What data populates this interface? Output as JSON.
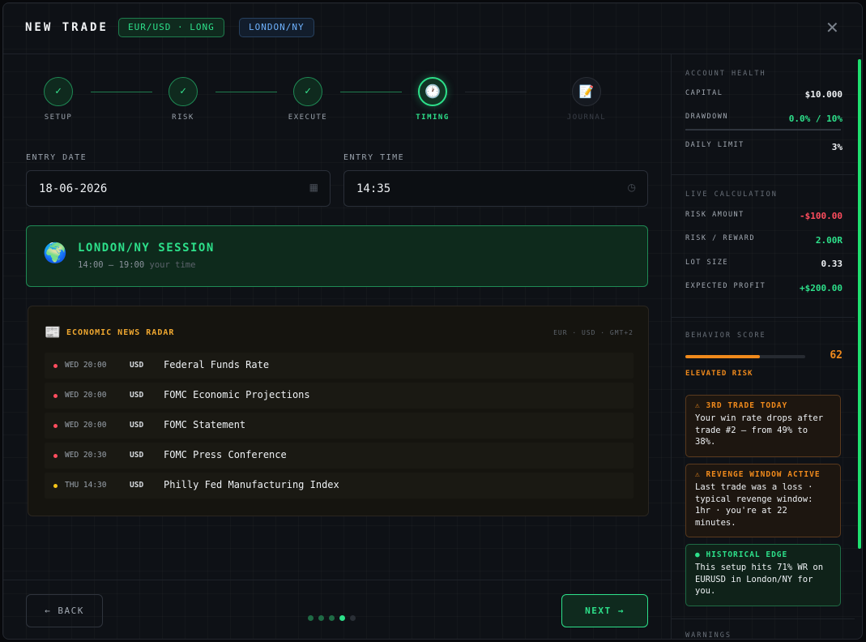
{
  "header": {
    "title": "NEW TRADE",
    "pair_pill": "EUR/USD · LONG",
    "session_pill": "LONDON/NY",
    "close_icon": "close-icon"
  },
  "stepper": {
    "steps": [
      {
        "label": "SETUP",
        "glyph": "✓",
        "state": "done"
      },
      {
        "label": "RISK",
        "glyph": "✓",
        "state": "done"
      },
      {
        "label": "EXECUTE",
        "glyph": "✓",
        "state": "done"
      },
      {
        "label": "TIMING",
        "glyph": "🕐",
        "state": "current"
      },
      {
        "label": "JOURNAL",
        "glyph": "📝",
        "state": "future"
      }
    ]
  },
  "form": {
    "entry_date_label": "ENTRY DATE",
    "entry_date_value": "18-06-2026",
    "entry_time_label": "ENTRY TIME",
    "entry_time_value": "14:35",
    "calendar_icon": "calendar-icon",
    "clock_icon": "clock-icon"
  },
  "session": {
    "icon": "globe-icon",
    "title": "LONDON/NY SESSION",
    "hours": "14:00 – 19:00",
    "hours_suffix": "your time"
  },
  "news": {
    "icon": "newspaper-icon",
    "title": "ECONOMIC NEWS RADAR",
    "meta": "EUR · USD · GMT+2",
    "impact_colors": {
      "high": "#ff4d5e",
      "medium": "#f5c518"
    },
    "events": [
      {
        "time": "WED 20:00",
        "currency": "USD",
        "name": "Federal Funds Rate",
        "impact": "high"
      },
      {
        "time": "WED 20:00",
        "currency": "USD",
        "name": "FOMC Economic Projections",
        "impact": "high"
      },
      {
        "time": "WED 20:00",
        "currency": "USD",
        "name": "FOMC Statement",
        "impact": "high"
      },
      {
        "time": "WED 20:30",
        "currency": "USD",
        "name": "FOMC Press Conference",
        "impact": "high"
      },
      {
        "time": "THU 14:30",
        "currency": "USD",
        "name": "Philly Fed Manufacturing Index",
        "impact": "medium"
      }
    ]
  },
  "footer": {
    "back_label": "← BACK",
    "next_label": "NEXT →",
    "page_dots": {
      "total": 5,
      "current": 4
    }
  },
  "sidebar": {
    "account": {
      "title": "ACCOUNT HEALTH",
      "capital_label": "CAPITAL",
      "capital_value": "$10.000",
      "drawdown_label": "DRAWDOWN",
      "drawdown_value": "0.0% / 10%",
      "drawdown_fraction": 0.0,
      "daily_limit_label": "DAILY LIMIT",
      "daily_limit_value": "3%"
    },
    "live": {
      "title": "LIVE CALCULATION",
      "risk_amount_label": "RISK AMOUNT",
      "risk_amount_value": "-$100.00",
      "rr_label": "RISK / REWARD",
      "rr_value": "2.00R",
      "lot_label": "LOT SIZE",
      "lot_value": "0.33",
      "profit_label": "EXPECTED PROFIT",
      "profit_value": "+$200.00"
    },
    "behavior": {
      "title": "BEHAVIOR SCORE",
      "score": "62",
      "score_fraction": 0.62,
      "status": "ELEVATED RISK",
      "cards": [
        {
          "kind": "warn",
          "title": "⚠ 3RD TRADE TODAY",
          "body": "Your win rate drops after trade #2 — from 49% to 38%."
        },
        {
          "kind": "warn",
          "title": "⚠ REVENGE WINDOW ACTIVE",
          "body": "Last trade was a loss · typical revenge window: 1hr · you're at 22 minutes."
        },
        {
          "kind": "good",
          "title": "● HISTORICAL EDGE",
          "body": "This setup hits 71% WR on EURUSD in London/NY for you."
        }
      ]
    },
    "warnings_title": "WARNINGS"
  },
  "colors": {
    "accent_green": "#2de08a",
    "danger_red": "#ff4d5e",
    "warn_orange": "#f08a1c",
    "info_blue": "#6fb3ff"
  }
}
